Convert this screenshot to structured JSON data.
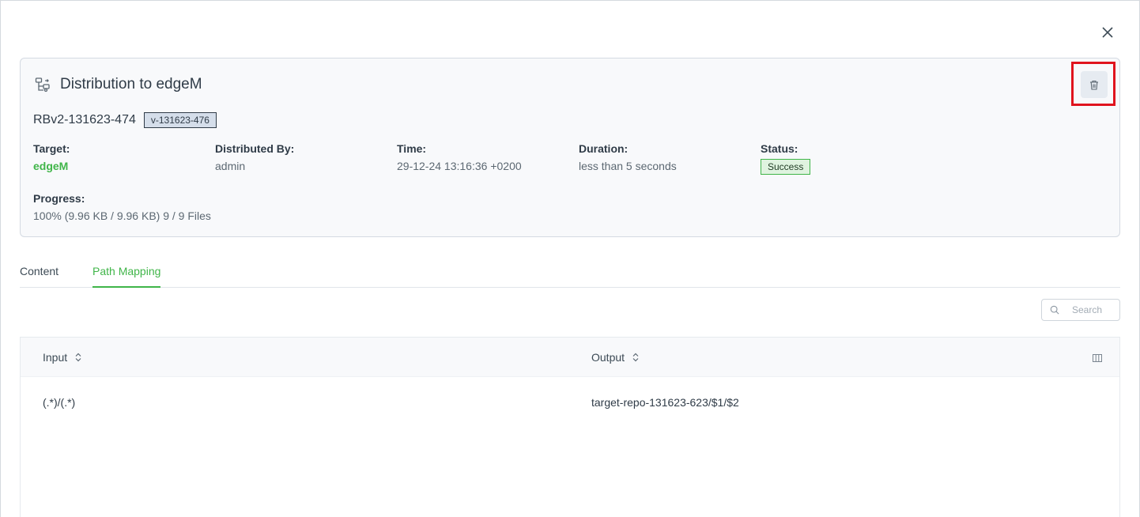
{
  "dialog": {
    "close_icon": "close-icon"
  },
  "card": {
    "title": "Distribution to edgeM",
    "title_icon": "distribution-icon",
    "delete_icon": "trash-icon",
    "bundle_name": "RBv2-131623-474",
    "version": "v-131623-476",
    "fields": {
      "target": {
        "label": "Target:",
        "value": "edgeM"
      },
      "distributed_by": {
        "label": "Distributed By:",
        "value": "admin"
      },
      "time": {
        "label": "Time:",
        "value": "29-12-24 13:16:36 +0200"
      },
      "duration": {
        "label": "Duration:",
        "value": "less than 5 seconds"
      },
      "status": {
        "label": "Status:",
        "value": "Success"
      },
      "progress": {
        "label": "Progress:",
        "value": "100% (9.96 KB / 9.96 KB) 9 / 9 Files"
      }
    }
  },
  "tabs": [
    {
      "label": "Content",
      "active": false
    },
    {
      "label": "Path Mapping",
      "active": true
    }
  ],
  "search": {
    "placeholder": "Search",
    "value": ""
  },
  "table": {
    "columns": [
      "Input",
      "Output"
    ],
    "rows": [
      {
        "input": "(.*)/(.*)",
        "output": "target-repo-131623-623/$1/$2"
      }
    ]
  },
  "colors": {
    "accent": "#40b549",
    "highlight": "#e0141e"
  }
}
